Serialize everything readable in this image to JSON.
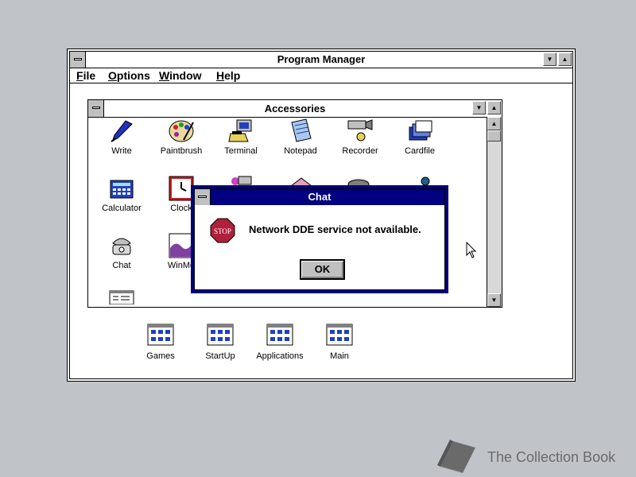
{
  "program_manager": {
    "title": "Program Manager",
    "menus": [
      {
        "key": "F",
        "rest": "ile"
      },
      {
        "key": "O",
        "rest": "ptions"
      },
      {
        "key": "W",
        "rest": "indow"
      },
      {
        "key": "H",
        "rest": "elp"
      }
    ]
  },
  "accessories": {
    "title": "Accessories",
    "icons": [
      {
        "label": "Write",
        "icon": "write-icon"
      },
      {
        "label": "Paintbrush",
        "icon": "paintbrush-icon"
      },
      {
        "label": "Terminal",
        "icon": "terminal-icon"
      },
      {
        "label": "Notepad",
        "icon": "notepad-icon"
      },
      {
        "label": "Recorder",
        "icon": "recorder-icon"
      },
      {
        "label": "Cardfile",
        "icon": "cardfile-icon"
      },
      {
        "label": "Calculator",
        "icon": "calculator-icon"
      },
      {
        "label": "Clock",
        "icon": "clock-icon"
      },
      {
        "label": "Chat",
        "icon": "chat-icon"
      },
      {
        "label": "WinMe",
        "icon": "winmeter-icon"
      }
    ]
  },
  "groups": [
    {
      "label": "Games",
      "icon": "program-group-icon"
    },
    {
      "label": "StartUp",
      "icon": "program-group-icon"
    },
    {
      "label": "Applications",
      "icon": "program-group-icon"
    },
    {
      "label": "Main",
      "icon": "program-group-icon"
    }
  ],
  "dialog": {
    "title": "Chat",
    "message": "Network DDE service not available.",
    "stop_text": "STOP",
    "ok_label": "OK"
  },
  "watermark": {
    "text": "The Collection Book",
    "icon": "book-icon"
  },
  "colors": {
    "desktop": "#c0c4c8",
    "dialog_title": "#000080",
    "stop": "#b0203a"
  }
}
